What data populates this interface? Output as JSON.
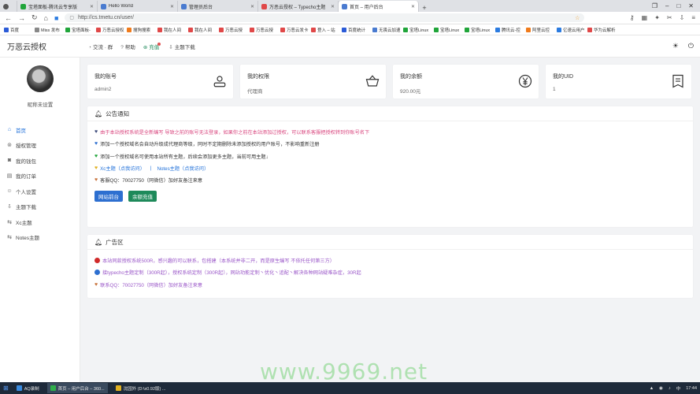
{
  "browser": {
    "tabs": [
      {
        "label": "宝塔面板-腾讯云专享版",
        "color": "#20a53a"
      },
      {
        "label": "Hello World",
        "color": "#4a7bd0"
      },
      {
        "label": "管理员后台",
        "color": "#4a7bd0"
      },
      {
        "label": "万恶云授权 – Typecho主题",
        "color": "#e04848"
      },
      {
        "label": "首页 – 用户后台",
        "color": "#4a7bd0"
      }
    ],
    "url": "http://cs.tmetu.cn/user/",
    "bookmarks": [
      {
        "label": "百度",
        "color": "#2b5bd7"
      },
      {
        "label": "Miss 发布",
        "color": "#888888"
      },
      {
        "label": "宝塔面板-",
        "color": "#20a53a"
      },
      {
        "label": "万恶云授权",
        "color": "#e04848"
      },
      {
        "label": "搜狗搜索",
        "color": "#f07b1b"
      },
      {
        "label": "我在人间",
        "color": "#e04848"
      },
      {
        "label": "我在人间",
        "color": "#e04848"
      },
      {
        "label": "万恶云授",
        "color": "#e04848"
      },
      {
        "label": "万恶云授",
        "color": "#e04848"
      },
      {
        "label": "万恶云发卡",
        "color": "#e04848"
      },
      {
        "label": "登入 – 站",
        "color": "#e04848"
      },
      {
        "label": "百度统计",
        "color": "#2b5bd7"
      },
      {
        "label": "无畏云加速",
        "color": "#4a7bd0"
      },
      {
        "label": "宝塔Linux",
        "color": "#20a53a"
      },
      {
        "label": "宝塔Linux",
        "color": "#20a53a"
      },
      {
        "label": "宝塔Linux",
        "color": "#20a53a"
      },
      {
        "label": "腾讯云-控",
        "color": "#2b7be0"
      },
      {
        "label": "阿里云控",
        "color": "#f07b1b"
      },
      {
        "label": "亿速云用户",
        "color": "#2b7be0"
      },
      {
        "label": "华为云解析",
        "color": "#e04848"
      }
    ]
  },
  "app": {
    "brand": "万恶云授权",
    "topnav": [
      {
        "label": "交流 · 群",
        "icon": "chat-icon"
      },
      {
        "label": "帮助",
        "icon": "help-icon"
      },
      {
        "label": "充值",
        "icon": "recharge-icon",
        "accent": "#1e8a5a"
      },
      {
        "label": "主题下载",
        "icon": "download-icon"
      }
    ]
  },
  "sidebar": {
    "nickname": "昵称未设置",
    "items": [
      {
        "label": "首页",
        "icon": "home-icon",
        "active": true
      },
      {
        "label": "授权管理",
        "icon": "auth-icon"
      },
      {
        "label": "我的钱包",
        "icon": "wallet-icon"
      },
      {
        "label": "我的订单",
        "icon": "order-icon"
      },
      {
        "label": "个人设置",
        "icon": "user-icon"
      },
      {
        "label": "主题下载",
        "icon": "download-icon"
      },
      {
        "label": "Xc主题",
        "icon": "theme-icon"
      },
      {
        "label": "Notes主题",
        "icon": "theme-icon"
      }
    ]
  },
  "cards": [
    {
      "label": "我的账号",
      "value": "admin2",
      "icon": "account-icon"
    },
    {
      "label": "我的权限",
      "value": "代理商",
      "icon": "basket-icon"
    },
    {
      "label": "我的余额",
      "value": "920.00元",
      "icon": "yen-icon"
    },
    {
      "label": "我的UID",
      "value": "1",
      "icon": "list-icon"
    }
  ],
  "notice": {
    "title": "公告通知",
    "lines": [
      {
        "text": "由于本站授权系统是全新编写 导致之前的账号无法登录，如果你之前在本站添加过授权，可以联系客服把授权转到你账号名下",
        "color": "#d9477f",
        "heart": "#3c4a7a"
      },
      {
        "text": "添加一个授权域名会自动升级成代理商等级，同时不定期删除未添加授权的用户账号，不影响重新注册",
        "color": "#333333",
        "heart": "#2d6fd0"
      },
      {
        "text": "添加一个授权域名可使用本站所有主题，后续会添加更多主题，当前可用主题↓",
        "color": "#333333",
        "heart": "#20a53a"
      },
      {
        "prefix": "Xc主题（点我访问）",
        "sep": "|",
        "suffix": "Notes主题（点我访问）",
        "color": "#1e6fd9",
        "heart": "#e0b020"
      },
      {
        "text": "客服QQ：70027750（同微信）加好友备注来意",
        "color": "#333333",
        "heart": "#c8723a"
      }
    ],
    "buttons": [
      {
        "label": "网站前台",
        "color": "#2d6fd0"
      },
      {
        "label": "余额充值",
        "color": "#1e8a5a"
      }
    ]
  },
  "ads": {
    "title": "广告区",
    "lines": [
      {
        "text": "本站同款授权系统500R，感兴趣的可以联系，包搭建（本系统并非二开，而是原生编写 不依托任何第三方）",
        "color": "#9a57c8",
        "marker": "#d02a2a",
        "shape": "circle"
      },
      {
        "text": "接typecho主题定制（300R起），授权系统定制（300R起），网站功能定制丶优化丶追配丶解决各种网站疑难杂症，30R起",
        "color": "#9a57c8",
        "marker": "#2d6fd0",
        "shape": "circle"
      },
      {
        "text": "联系QQ：70027750（同微信）加好友备注来意",
        "color": "#9a57c8",
        "marker": "#c8723a",
        "shape": "heart"
      }
    ]
  },
  "taskbar": {
    "items": [
      {
        "label": "AQ录制"
      },
      {
        "label": "首页 – 用户后台 – 360..."
      },
      {
        "label": "沈园外 (D:\\x0.92版) ..."
      }
    ],
    "time": "17:44"
  },
  "watermark": "www.9969.net"
}
